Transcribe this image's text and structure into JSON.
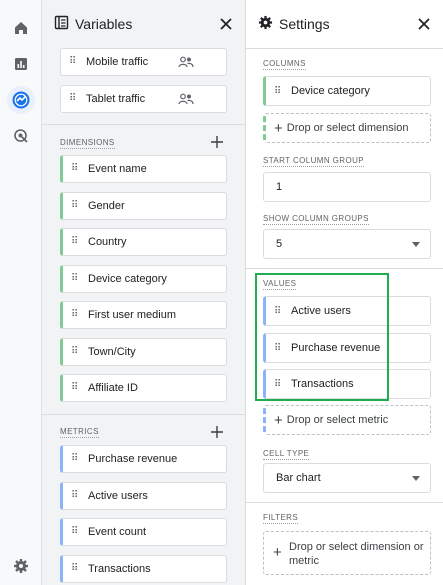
{
  "rail": {
    "icons": [
      "home-icon",
      "reports-icon",
      "explore-icon",
      "advertising-icon",
      "settings-icon"
    ]
  },
  "variables": {
    "title": "Variables",
    "segments": [
      {
        "label": "Mobile traffic"
      },
      {
        "label": "Tablet traffic"
      }
    ],
    "dimensions_label": "DIMENSIONS",
    "dimensions": [
      "Event name",
      "Gender",
      "Country",
      "Device category",
      "First user medium",
      "Town/City",
      "Affiliate ID"
    ],
    "metrics_label": "METRICS",
    "metrics": [
      "Purchase revenue",
      "Active users",
      "Event count",
      "Transactions"
    ]
  },
  "settings": {
    "title": "Settings",
    "columns_label": "COLUMNS",
    "columns": [
      "Device category"
    ],
    "columns_drop": "Drop or select dimension",
    "start_column_group_label": "START COLUMN GROUP",
    "start_column_group_value": "1",
    "show_column_groups_label": "SHOW COLUMN GROUPS",
    "show_column_groups_value": "5",
    "values_label": "VALUES",
    "values": [
      "Active users",
      "Purchase revenue",
      "Transactions"
    ],
    "values_drop": "Drop or select metric",
    "cell_type_label": "CELL TYPE",
    "cell_type_value": "Bar chart",
    "filters_label": "FILTERS",
    "filters_drop": "Drop or select dimension or metric"
  },
  "colors": {
    "dimension_accent": "#81c995",
    "metric_accent": "#8ab4f8",
    "highlight": "#1fae4f",
    "active_rail": "#1a73e8"
  }
}
